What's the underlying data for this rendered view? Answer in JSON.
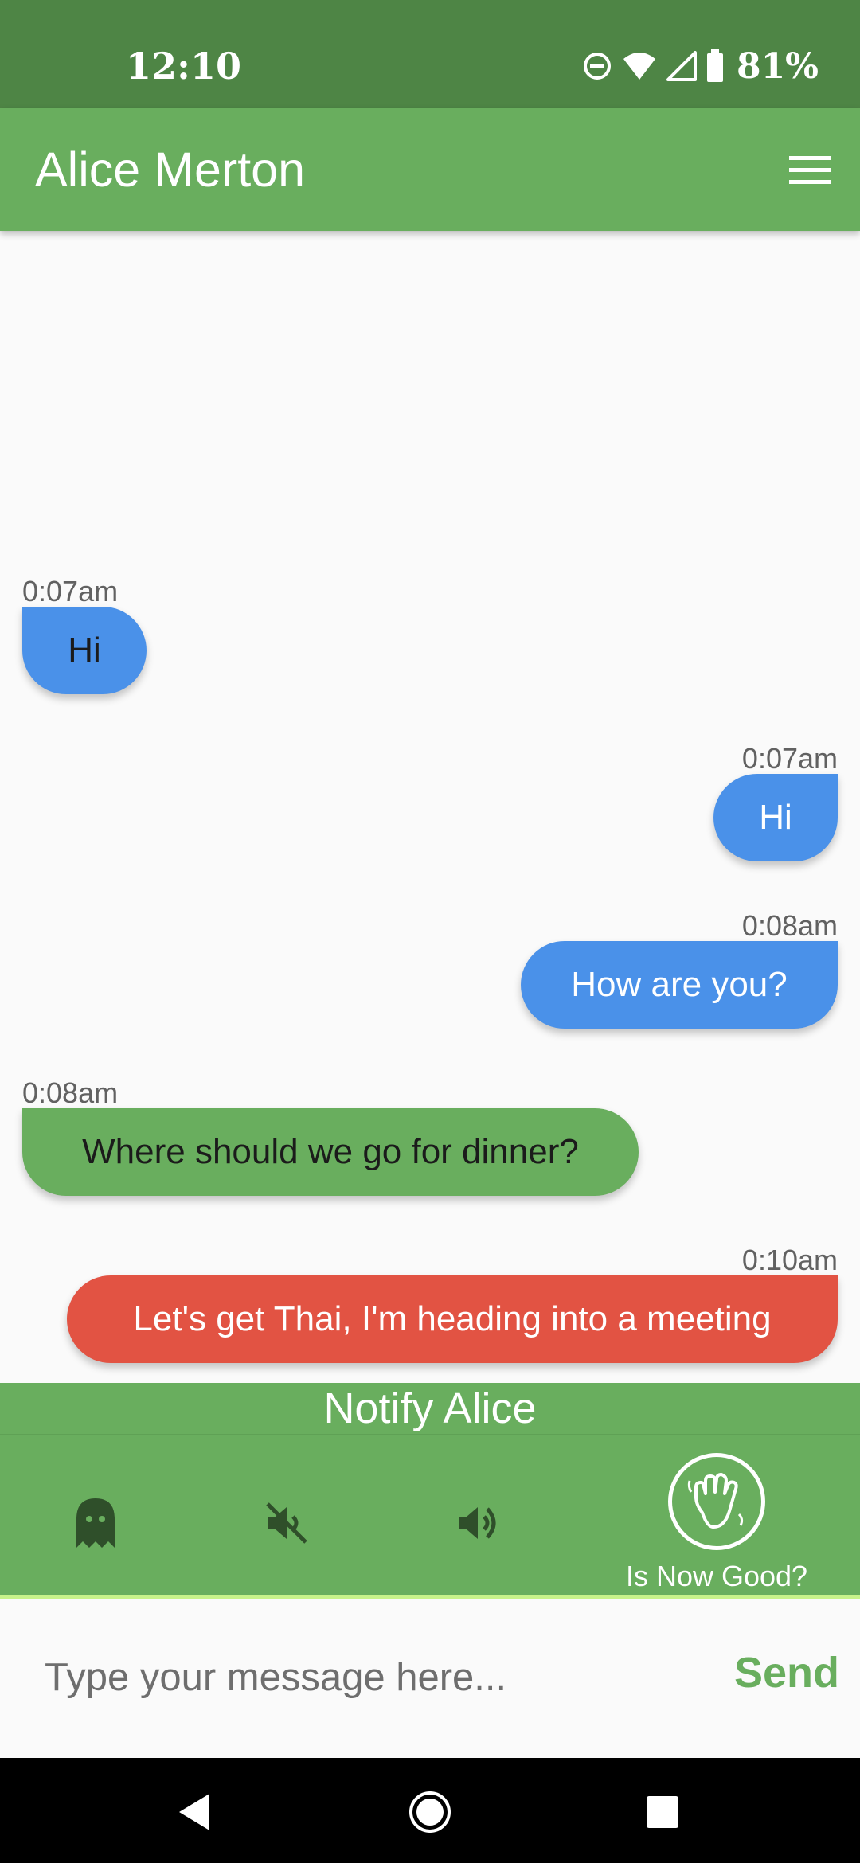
{
  "status_bar": {
    "time": "12:10",
    "battery_percent": "81%",
    "icons": [
      "do-not-disturb-icon",
      "wifi-icon",
      "cell-signal-icon",
      "battery-icon"
    ]
  },
  "app_bar": {
    "title": "Alice Merton",
    "menu_icon": "hamburger-menu-icon"
  },
  "messages": [
    {
      "time": "0:07am",
      "text": "Hi",
      "side": "left",
      "color": "#4a91e9"
    },
    {
      "time": "0:07am",
      "text": "Hi",
      "side": "right",
      "color": "#4a91e9"
    },
    {
      "time": "0:08am",
      "text": "How are you?",
      "side": "right",
      "color": "#4a91e9"
    },
    {
      "time": "0:08am",
      "text": "Where should we go for dinner?",
      "side": "left",
      "color": "#69ae5e"
    },
    {
      "time": "0:10am",
      "text": "Let's get Thai, I'm heading into a meeting",
      "side": "right",
      "color": "#e25343"
    }
  ],
  "notify": {
    "title": "Notify Alice",
    "actions": [
      {
        "icon": "ghost-icon"
      },
      {
        "icon": "volume-off-icon"
      },
      {
        "icon": "volume-up-icon"
      },
      {
        "icon": "waving-hand-icon",
        "label": "Is Now Good?"
      }
    ]
  },
  "input": {
    "placeholder": "Type your message here...",
    "value": "",
    "send_label": "Send"
  },
  "colors": {
    "status_bar": "#4e8545",
    "primary": "#69ae5e",
    "bubble_blue": "#4a91e9",
    "bubble_red": "#e25343",
    "accent_line": "#c7f28a"
  },
  "nav_bar": {
    "icons": [
      "back-icon",
      "home-icon",
      "recents-icon"
    ]
  }
}
